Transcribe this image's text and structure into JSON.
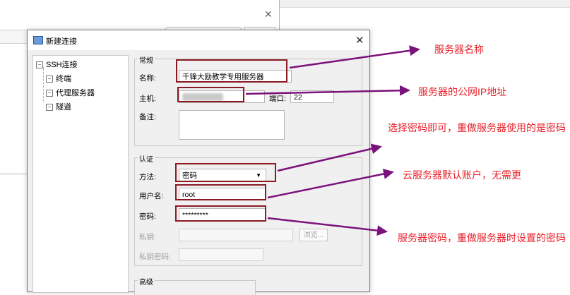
{
  "dialog": {
    "title": "新建连接"
  },
  "tree": {
    "root": "SSH连接",
    "children": [
      "终端",
      "代理服务器",
      "隧道"
    ]
  },
  "general": {
    "title": "常规",
    "name_label": "名称:",
    "name_value": "千锋大励教学专用服务器",
    "host_label": "主机:",
    "port_label": "端口:",
    "port_value": "22",
    "note_label": "备注:"
  },
  "auth": {
    "title": "认证",
    "method_label": "方法:",
    "method_value": "密码",
    "user_label": "用户名:",
    "user_value": "root",
    "password_label": "密码:",
    "password_value": "*********",
    "key_label": "私钥:",
    "browse_label": "浏览...",
    "key_pass_label": "私钥密码:"
  },
  "advanced": {
    "title": "高级"
  },
  "annotations": {
    "server_name": "服务器名称",
    "public_ip": "服务器的公网IP地址",
    "choose_password": "选择密码即可，重做服务器使用的是密码",
    "default_account": "云服务器默认账户，无需更",
    "server_password": "服务器密码，重做服务器时设置的密码"
  },
  "colors": {
    "annotation": "#e8202a",
    "arrow": "#7b117b",
    "highlight": "#8b1a24"
  }
}
